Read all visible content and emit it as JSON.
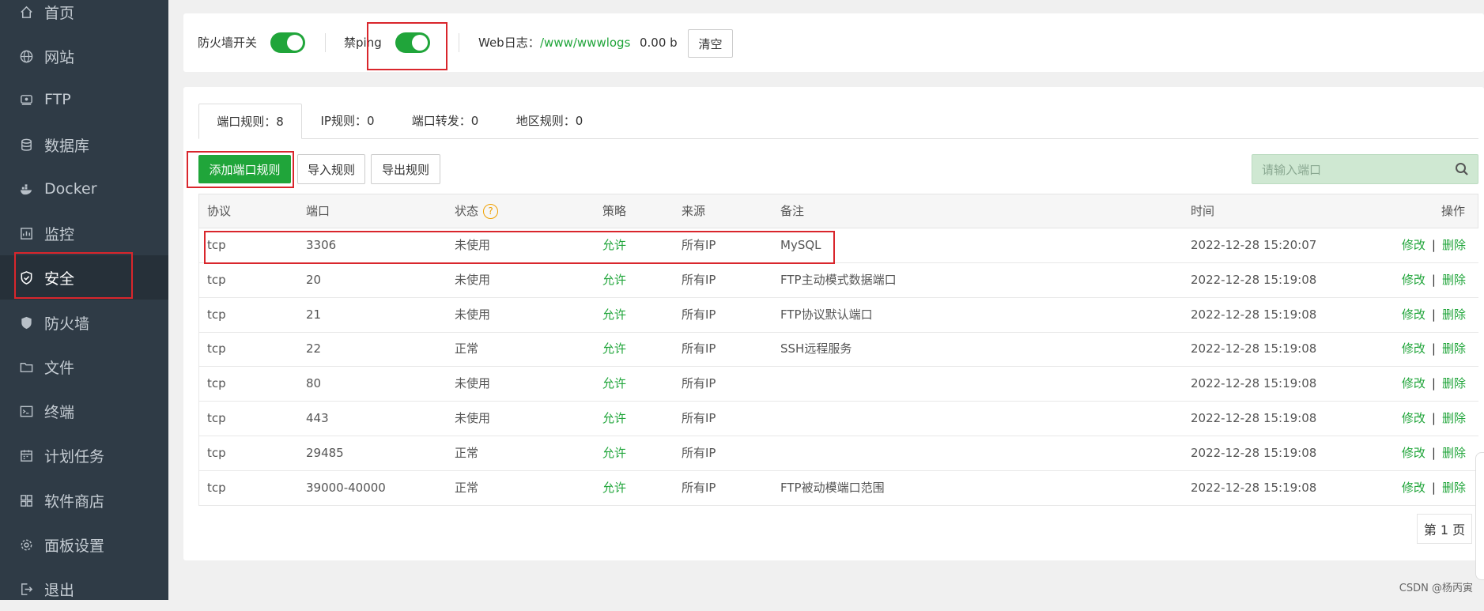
{
  "sidebar": {
    "items": [
      {
        "label": "首页",
        "icon": "home-icon"
      },
      {
        "label": "网站",
        "icon": "globe-icon"
      },
      {
        "label": "FTP",
        "icon": "ftp-icon"
      },
      {
        "label": "数据库",
        "icon": "database-icon"
      },
      {
        "label": "Docker",
        "icon": "docker-icon"
      },
      {
        "label": "监控",
        "icon": "monitor-icon"
      },
      {
        "label": "安全",
        "icon": "shield-check-icon"
      },
      {
        "label": "防火墙",
        "icon": "shield-icon"
      },
      {
        "label": "文件",
        "icon": "folder-icon"
      },
      {
        "label": "终端",
        "icon": "terminal-icon"
      },
      {
        "label": "计划任务",
        "icon": "calendar-icon"
      },
      {
        "label": "软件商店",
        "icon": "apps-icon"
      },
      {
        "label": "面板设置",
        "icon": "gear-icon"
      },
      {
        "label": "退出",
        "icon": "logout-icon"
      }
    ],
    "active": "安全"
  },
  "topbar": {
    "firewall_label": "防火墙开关",
    "firewall_on": true,
    "ping_label": "禁ping",
    "ping_on": true,
    "weblog_label": "Web日志：",
    "weblog_path": "/www/wwwlogs",
    "weblog_size": "0.00 b",
    "clear_label": "清空"
  },
  "tabs": [
    {
      "label": "端口规则：8",
      "active": true
    },
    {
      "label": "IP规则：0",
      "active": false
    },
    {
      "label": "端口转发：0",
      "active": false
    },
    {
      "label": "地区规则：0",
      "active": false
    }
  ],
  "toolbar": {
    "add_label": "添加端口规则",
    "import_label": "导入规则",
    "export_label": "导出规则",
    "search_placeholder": "请输入端口"
  },
  "table": {
    "columns": {
      "protocol": "协议",
      "port": "端口",
      "status": "状态",
      "policy": "策略",
      "source": "来源",
      "remark": "备注",
      "time": "时间",
      "action": "操作"
    },
    "rows": [
      {
        "protocol": "tcp",
        "port": "3306",
        "status": "未使用",
        "policy": "允许",
        "source": "所有IP",
        "remark": "MySQL",
        "time": "2022-12-28 15:20:07"
      },
      {
        "protocol": "tcp",
        "port": "20",
        "status": "未使用",
        "policy": "允许",
        "source": "所有IP",
        "remark": "FTP主动模式数据端口",
        "time": "2022-12-28 15:19:08"
      },
      {
        "protocol": "tcp",
        "port": "21",
        "status": "未使用",
        "policy": "允许",
        "source": "所有IP",
        "remark": "FTP协议默认端口",
        "time": "2022-12-28 15:19:08"
      },
      {
        "protocol": "tcp",
        "port": "22",
        "status": "正常",
        "policy": "允许",
        "source": "所有IP",
        "remark": "SSH远程服务",
        "time": "2022-12-28 15:19:08"
      },
      {
        "protocol": "tcp",
        "port": "80",
        "status": "未使用",
        "policy": "允许",
        "source": "所有IP",
        "remark": "",
        "time": "2022-12-28 15:19:08"
      },
      {
        "protocol": "tcp",
        "port": "443",
        "status": "未使用",
        "policy": "允许",
        "source": "所有IP",
        "remark": "",
        "time": "2022-12-28 15:19:08"
      },
      {
        "protocol": "tcp",
        "port": "29485",
        "status": "正常",
        "policy": "允许",
        "source": "所有IP",
        "remark": "",
        "time": "2022-12-28 15:19:08"
      },
      {
        "protocol": "tcp",
        "port": "39000-40000",
        "status": "正常",
        "policy": "允许",
        "source": "所有IP",
        "remark": "FTP被动模端口范围",
        "time": "2022-12-28 15:19:08"
      }
    ],
    "edit_label": "修改",
    "delete_label": "删除",
    "action_separator": "|"
  },
  "pagination": {
    "label": "第 1 页"
  },
  "watermark": "CSDN @杨丙寅",
  "colors": {
    "accent": "#20a53a",
    "sidebar": "#2f3b46",
    "highlight": "#d9262c"
  }
}
